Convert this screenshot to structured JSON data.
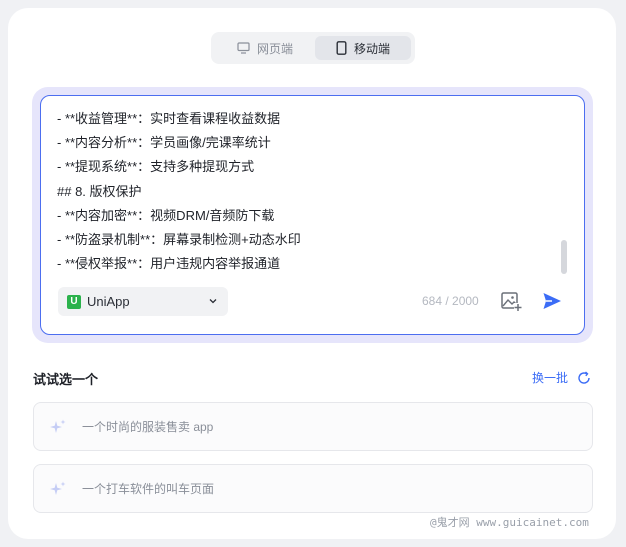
{
  "tabs": {
    "web_label": "网页端",
    "mobile_label": "移动端"
  },
  "editor": {
    "lines": [
      "- **收益管理**：实时查看课程收益数据",
      "- **内容分析**：学员画像/完课率统计",
      "- **提现系统**：支持多种提现方式",
      "## 8. 版权保护",
      "- **内容加密**：视频DRM/音频防下载",
      "- **防盗录机制**：屏幕录制检测+动态水印",
      "- **侵权举报**：用户违规内容举报通道"
    ],
    "framework": "UniApp",
    "counter": "684 / 2000"
  },
  "suggest": {
    "title": "试试选一个",
    "refresh_label": "换一批",
    "items": [
      "一个时尚的服装售卖 app",
      "一个打车软件的叫车页面"
    ]
  },
  "watermark": "@鬼才网 www.guicainet.com",
  "colors": {
    "accent": "#4c6ef0",
    "send": "#3b6cf6",
    "framework_logo": "#2bb24c"
  },
  "icons": [
    "monitor-icon",
    "phone-icon",
    "uniapp-logo-icon",
    "chevron-down-icon",
    "image-upload-icon",
    "send-icon",
    "sparkle-icon",
    "refresh-icon"
  ]
}
